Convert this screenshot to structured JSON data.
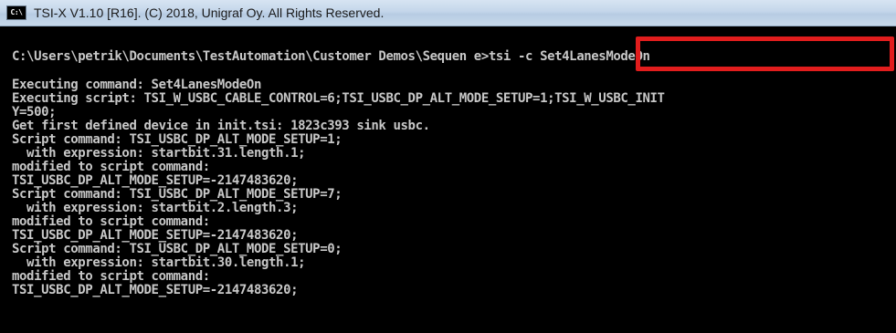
{
  "window": {
    "icon_text": "C:\\",
    "title": "TSI-X V1.10 [R16]. (C) 2018, Unigraf Oy. All Rights Reserved."
  },
  "console": {
    "prompt_line": "C:\\Users\\petrik\\Documents\\TestAutomation\\Customer Demos\\Sequen e>tsi -c Set4LanesModeOn",
    "output_lines": [
      "Executing command: Set4LanesModeOn",
      "Executing script: TSI_W_USBC_CABLE_CONTROL=6;TSI_USBC_DP_ALT_MODE_SETUP=1;TSI_W_USBC_INIT",
      "Y=500;",
      "Get first defined device in init.tsi: 1823c393 sink usbc.",
      "Script command: TSI_USBC_DP_ALT_MODE_SETUP=1;",
      "  with expression: startbit.31.length.1;",
      "modified to script command:",
      "TSI_USBC_DP_ALT_MODE_SETUP=-2147483620;",
      "Script command: TSI_USBC_DP_ALT_MODE_SETUP=7;",
      "  with expression: startbit.2.length.3;",
      "modified to script command:",
      "TSI_USBC_DP_ALT_MODE_SETUP=-2147483620;",
      "Script command: TSI_USBC_DP_ALT_MODE_SETUP=0;",
      "  with expression: startbit.30.length.1;",
      "modified to script command:",
      "TSI_USBC_DP_ALT_MODE_SETUP=-2147483620;"
    ]
  },
  "colors": {
    "console_background": "#000000",
    "console_text": "#c8c8c8",
    "highlight_border": "#e11d1d"
  }
}
